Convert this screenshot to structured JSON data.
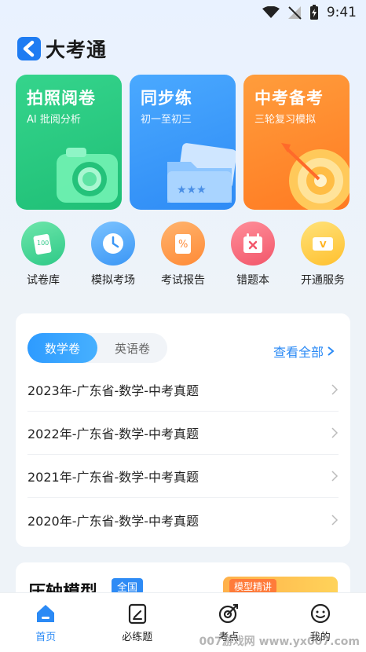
{
  "status_bar": {
    "time": "9:41"
  },
  "header": {
    "app_title": "大考通"
  },
  "feature_cards": [
    {
      "title": "拍照阅卷",
      "subtitle": "AI 批阅分析",
      "color": "#27c97f"
    },
    {
      "title": "同步练",
      "subtitle": "初一至初三",
      "color": "#3a9bf8"
    },
    {
      "title": "中考备考",
      "subtitle": "三轮复习模拟",
      "color": "#ff8a2c"
    }
  ],
  "tools": [
    {
      "label": "试卷库",
      "icon": "paper-stack-icon"
    },
    {
      "label": "模拟考场",
      "icon": "clock-icon"
    },
    {
      "label": "考试报告",
      "icon": "report-percent-icon"
    },
    {
      "label": "错题本",
      "icon": "calendar-wrong-icon"
    },
    {
      "label": "开通服务",
      "icon": "vip-card-icon"
    }
  ],
  "papers": {
    "tabs": [
      {
        "label": "数学卷",
        "active": true
      },
      {
        "label": "英语卷",
        "active": false
      }
    ],
    "view_all": "查看全部",
    "rows": [
      "2023年-广东省-数学-中考真题",
      "2022年-广东省-数学-中考真题",
      "2021年-广东省-数学-中考真题",
      "2020年-广东省-数学-中考真题"
    ]
  },
  "section2": {
    "title": "压轴模型",
    "badge": "全国",
    "promo": "模型精讲"
  },
  "bottom_nav": [
    {
      "label": "首页",
      "icon": "home-icon",
      "active": true
    },
    {
      "label": "必练题",
      "icon": "edit-paper-icon",
      "active": false
    },
    {
      "label": "考点",
      "icon": "target-icon",
      "active": false
    },
    {
      "label": "我的",
      "icon": "profile-smile-icon",
      "active": false
    }
  ],
  "watermark": "007游戏网 www.yx007.com"
}
